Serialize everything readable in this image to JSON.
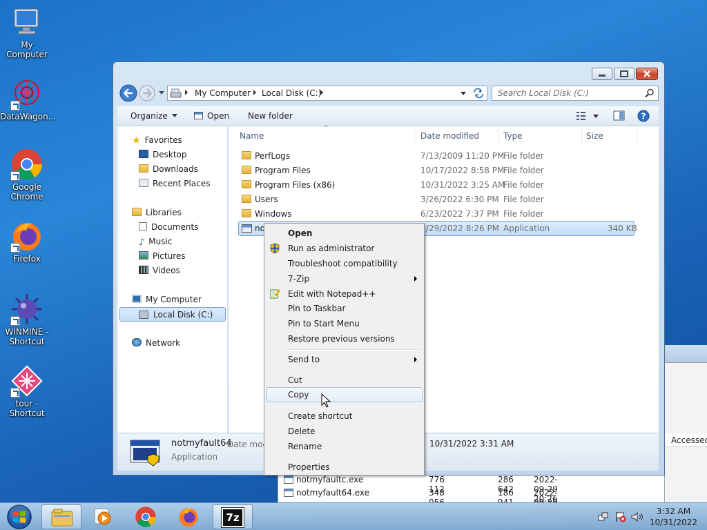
{
  "desktop": {
    "icons": [
      {
        "label": "My Computer",
        "icon": "computer-icon"
      },
      {
        "label": "DataWagon...",
        "icon": "datawagon-icon"
      },
      {
        "label": "Google Chrome",
        "icon": "chrome-icon"
      },
      {
        "label": "Firefox",
        "icon": "firefox-icon"
      },
      {
        "label": "WINMINE - Shortcut",
        "icon": "winmine-icon"
      },
      {
        "label": "tour - Shortcut",
        "icon": "tour-icon"
      }
    ]
  },
  "explorer": {
    "breadcrumb": [
      "My Computer",
      "Local Disk (C:)"
    ],
    "search_placeholder": "Search Local Disk (C:)",
    "toolbar": {
      "organize": "Organize",
      "open": "Open",
      "new_folder": "New folder"
    },
    "nav": {
      "favorites": "Favorites",
      "desktop": "Desktop",
      "downloads": "Downloads",
      "recent": "Recent Places",
      "libraries": "Libraries",
      "documents": "Documents",
      "music": "Music",
      "pictures": "Pictures",
      "videos": "Videos",
      "my_computer": "My Computer",
      "local_disk": "Local Disk (C:)",
      "network": "Network"
    },
    "columns": {
      "name": "Name",
      "date": "Date modified",
      "type": "Type",
      "size": "Size"
    },
    "rows": [
      {
        "name": "PerfLogs",
        "date": "7/13/2009 11:20 PM",
        "type": "File folder",
        "size": ""
      },
      {
        "name": "Program Files",
        "date": "10/17/2022 8:58 PM",
        "type": "File folder",
        "size": ""
      },
      {
        "name": "Program Files (x86)",
        "date": "10/31/2022 3:25 AM",
        "type": "File folder",
        "size": ""
      },
      {
        "name": "Users",
        "date": "3/26/2022 6:30 PM",
        "type": "File folder",
        "size": ""
      },
      {
        "name": "Windows",
        "date": "6/23/2022 7:37 PM",
        "type": "File folder",
        "size": ""
      },
      {
        "name": "no",
        "date": "/29/2022 8:26 PM",
        "type": "Application",
        "size": "340 KB"
      }
    ],
    "details": {
      "name": "notmyfault64",
      "date_label": "Date mod",
      "date_value": "10/31/2022 3:31 AM",
      "type": "Application"
    }
  },
  "context_menu": {
    "items": [
      "Open",
      "Run as administrator",
      "Troubleshoot compatibility",
      "7-Zip",
      "Edit with Notepad++",
      "Pin to Taskbar",
      "Pin to Start Menu",
      "Restore previous versions",
      "Send to",
      "Cut",
      "Copy",
      "Create shortcut",
      "Delete",
      "Rename",
      "Properties"
    ]
  },
  "back_window": {
    "accessed": "Accessed",
    "rows": [
      {
        "name": "notmyfaultc.exe",
        "size": "776 112",
        "packed": "286 642",
        "modified": "2022-09-29 20:26"
      },
      {
        "name": "notmyfault64.exe",
        "size": "348 056",
        "packed": "186 941",
        "modified": "2022-09-29 20:26"
      }
    ]
  },
  "taskbar": {
    "time": "3:32 AM",
    "date": "10/31/2022",
    "sevenzip_label": "7z"
  }
}
